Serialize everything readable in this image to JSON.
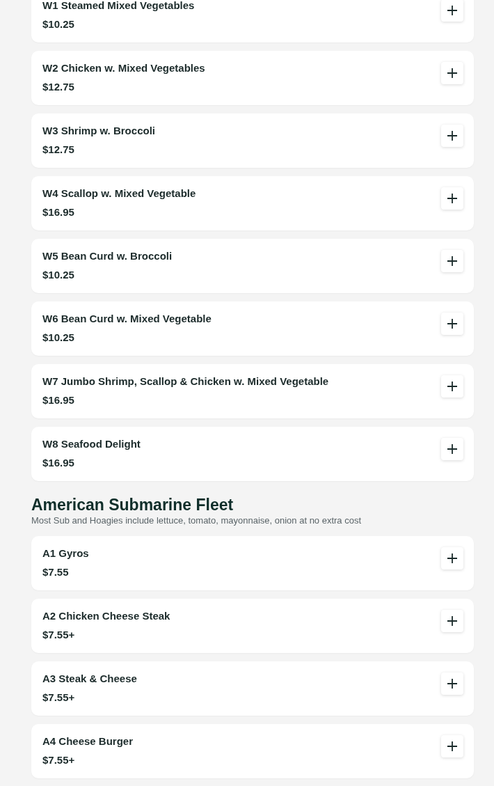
{
  "sections": [
    {
      "items": [
        {
          "name": "W1 Steamed Mixed Vegetables",
          "price": "$10.25"
        },
        {
          "name": "W2 Chicken w. Mixed Vegetables",
          "price": "$12.75"
        },
        {
          "name": "W3 Shrimp w. Broccoli",
          "price": "$12.75"
        },
        {
          "name": "W4 Scallop w. Mixed Vegetable",
          "price": "$16.95"
        },
        {
          "name": "W5 Bean Curd w. Broccoli",
          "price": "$10.25"
        },
        {
          "name": "W6 Bean Curd w. Mixed Vegetable",
          "price": "$10.25"
        },
        {
          "name": "W7 Jumbo Shrimp, Scallop & Chicken w. Mixed Vegetable",
          "price": "$16.95"
        },
        {
          "name": "W8 Seafood Delight",
          "price": "$16.95"
        }
      ]
    },
    {
      "title": "American Submarine Fleet",
      "description": "Most Sub and Hoagies include lettuce, tomato, mayonnaise, onion at no extra cost",
      "items": [
        {
          "name": "A1 Gyros",
          "price": "$7.55"
        },
        {
          "name": "A2 Chicken Cheese Steak",
          "price": "$7.55+"
        },
        {
          "name": "A3 Steak & Cheese",
          "price": "$7.55+"
        },
        {
          "name": "A4 Cheese Burger",
          "price": "$7.55+"
        }
      ]
    }
  ]
}
